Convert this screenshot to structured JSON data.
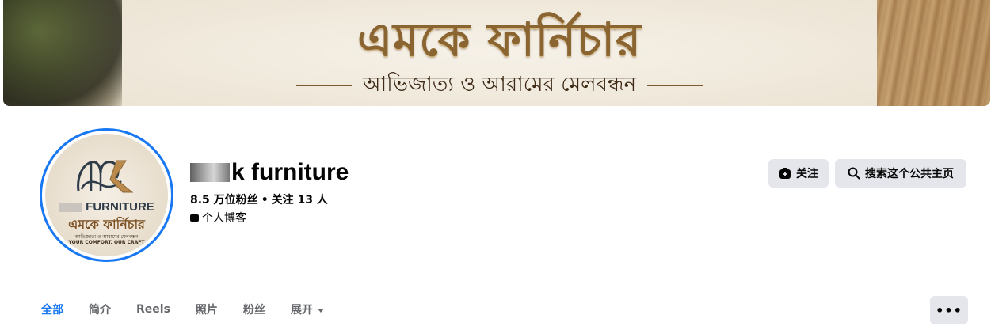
{
  "cover": {
    "title": "এমকে ফার্নিচার",
    "subtitle": "আভিজাত্য ও আরামের মেলবন্ধন"
  },
  "avatar": {
    "brand": "FURNITURE",
    "name_bn": "এমকে ফার্নিচার",
    "tagline_bn": "আভিজাত্য ও আরামের মেলবন্ধন",
    "tagline_en": "YOUR COMFORT, OUR CRAFT"
  },
  "profile": {
    "name": "k furniture",
    "followers": "8.5 万位粉丝",
    "dot": "•",
    "following": "关注 13 人",
    "category": "个人博客"
  },
  "actions": {
    "follow_label": "关注",
    "search_label": "搜索这个公共主页"
  },
  "tabs": [
    {
      "label": "全部"
    },
    {
      "label": "简介"
    },
    {
      "label": "Reels"
    },
    {
      "label": "照片"
    },
    {
      "label": "粉丝"
    },
    {
      "label": "展开"
    }
  ],
  "more": {
    "label": "•••"
  },
  "colors": {
    "accent": "#1877f2",
    "button_bg": "#e4e6eb",
    "secondary_text": "#65676b"
  }
}
